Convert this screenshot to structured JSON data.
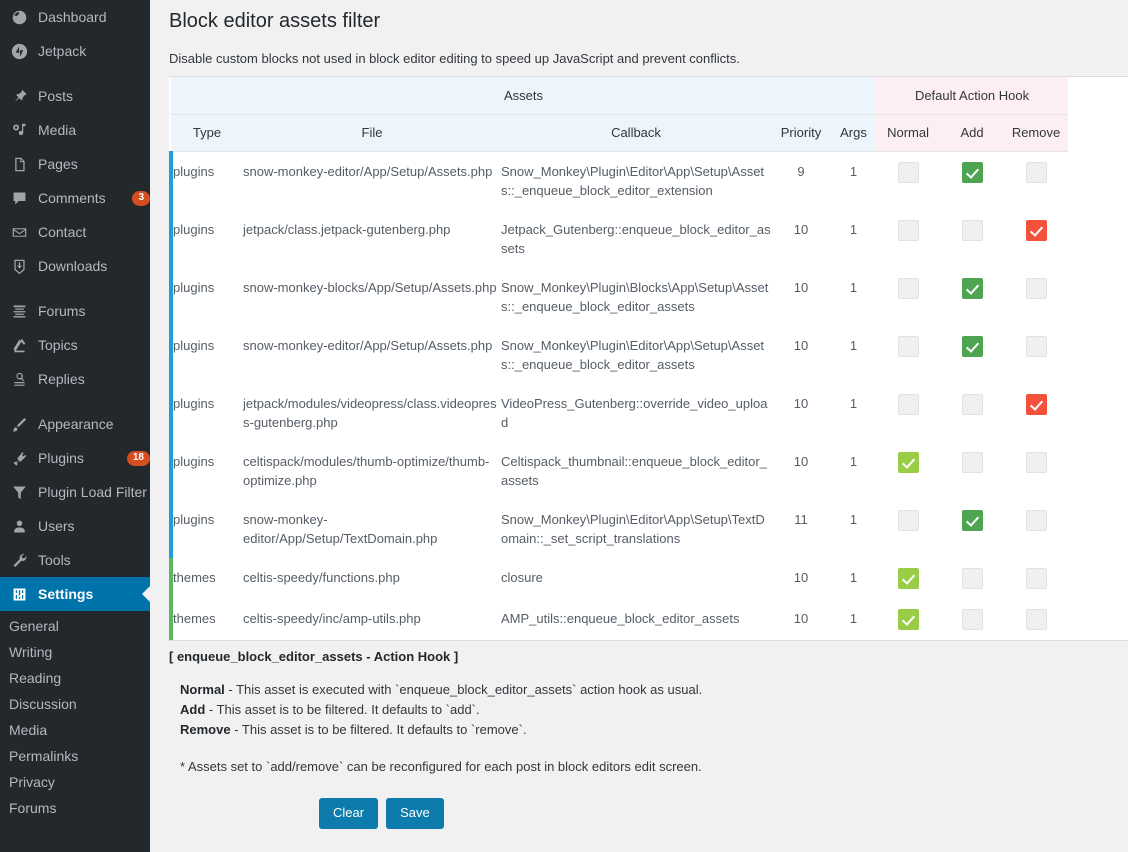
{
  "sidebar": {
    "items": [
      {
        "label": "Dashboard",
        "icon": "dashboard-icon",
        "name": "sidebar-item-dashboard",
        "gap": false
      },
      {
        "label": "Jetpack",
        "icon": "jetpack-icon",
        "name": "sidebar-item-jetpack",
        "gap": false
      },
      {
        "label": "Posts",
        "icon": "pin-icon",
        "name": "sidebar-item-posts",
        "gap": true
      },
      {
        "label": "Media",
        "icon": "media-icon",
        "name": "sidebar-item-media",
        "gap": false
      },
      {
        "label": "Pages",
        "icon": "pages-icon",
        "name": "sidebar-item-pages",
        "gap": false
      },
      {
        "label": "Comments",
        "icon": "comment-icon",
        "name": "sidebar-item-comments",
        "gap": false,
        "badge": "3"
      },
      {
        "label": "Contact",
        "icon": "envelope-icon",
        "name": "sidebar-item-contact",
        "gap": false
      },
      {
        "label": "Downloads",
        "icon": "download-icon",
        "name": "sidebar-item-downloads",
        "gap": false
      },
      {
        "label": "Forums",
        "icon": "forums-icon",
        "name": "sidebar-item-forums",
        "gap": true
      },
      {
        "label": "Topics",
        "icon": "topics-icon",
        "name": "sidebar-item-topics",
        "gap": false
      },
      {
        "label": "Replies",
        "icon": "replies-icon",
        "name": "sidebar-item-replies",
        "gap": false
      },
      {
        "label": "Appearance",
        "icon": "brush-icon",
        "name": "sidebar-item-appearance",
        "gap": true
      },
      {
        "label": "Plugins",
        "icon": "plugin-icon",
        "name": "sidebar-item-plugins",
        "gap": false,
        "badge": "18"
      },
      {
        "label": "Plugin Load Filter",
        "icon": "filter-icon",
        "name": "sidebar-item-plugin-load-filter",
        "gap": false
      },
      {
        "label": "Users",
        "icon": "user-icon",
        "name": "sidebar-item-users",
        "gap": false
      },
      {
        "label": "Tools",
        "icon": "wrench-icon",
        "name": "sidebar-item-tools",
        "gap": false
      },
      {
        "label": "Settings",
        "icon": "settings-icon",
        "name": "sidebar-item-settings",
        "gap": false,
        "current": true
      }
    ],
    "submenu": [
      {
        "label": "General",
        "name": "submenu-item-general"
      },
      {
        "label": "Writing",
        "name": "submenu-item-writing"
      },
      {
        "label": "Reading",
        "name": "submenu-item-reading"
      },
      {
        "label": "Discussion",
        "name": "submenu-item-discussion"
      },
      {
        "label": "Media",
        "name": "submenu-item-media"
      },
      {
        "label": "Permalinks",
        "name": "submenu-item-permalinks"
      },
      {
        "label": "Privacy",
        "name": "submenu-item-privacy"
      },
      {
        "label": "Forums",
        "name": "submenu-item-forums"
      }
    ],
    "accent_current": "#0073aa",
    "badge_color": "#d54e21"
  },
  "page": {
    "title": "Block editor assets filter",
    "description": "Disable custom blocks not used in block editor editing to speed up JavaScript and prevent conflicts."
  },
  "table": {
    "group_headers": [
      {
        "label": "Assets",
        "name": "group-header-assets",
        "color": "#eef4fb"
      },
      {
        "label": "Default Action Hook",
        "name": "group-header-default-action-hook",
        "color": "#fdeef1"
      }
    ],
    "columns": [
      {
        "label": "Type",
        "name": "column-header-type"
      },
      {
        "label": "File",
        "name": "column-header-file"
      },
      {
        "label": "Callback",
        "name": "column-header-callback"
      },
      {
        "label": "Priority",
        "name": "column-header-priority"
      },
      {
        "label": "Args",
        "name": "column-header-args"
      },
      {
        "label": "Normal",
        "name": "column-header-normal"
      },
      {
        "label": "Add",
        "name": "column-header-add"
      },
      {
        "label": "Remove",
        "name": "column-header-remove"
      }
    ],
    "rows": [
      {
        "type": "plugins",
        "file": "snow-monkey-editor/App/Setup/Assets.php",
        "callback": "Snow_Monkey\\Plugin\\Editor\\App\\Setup\\Assets::_enqueue_block_editor_extension",
        "priority": "9",
        "args": "1",
        "normal": false,
        "add": true,
        "remove": false
      },
      {
        "type": "plugins",
        "file": "jetpack/class.jetpack-gutenberg.php",
        "callback": "Jetpack_Gutenberg::enqueue_block_editor_assets",
        "priority": "10",
        "args": "1",
        "normal": false,
        "add": false,
        "remove": true
      },
      {
        "type": "plugins",
        "file": "snow-monkey-blocks/App/Setup/Assets.php",
        "callback": "Snow_Monkey\\Plugin\\Blocks\\App\\Setup\\Assets::_enqueue_block_editor_assets",
        "priority": "10",
        "args": "1",
        "normal": false,
        "add": true,
        "remove": false
      },
      {
        "type": "plugins",
        "file": "snow-monkey-editor/App/Setup/Assets.php",
        "callback": "Snow_Monkey\\Plugin\\Editor\\App\\Setup\\Assets::_enqueue_block_editor_assets",
        "priority": "10",
        "args": "1",
        "normal": false,
        "add": true,
        "remove": false
      },
      {
        "type": "plugins",
        "file": "jetpack/modules/videopress/class.videopress-gutenberg.php",
        "callback": "VideoPress_Gutenberg::override_video_upload",
        "priority": "10",
        "args": "1",
        "normal": false,
        "add": false,
        "remove": true
      },
      {
        "type": "plugins",
        "file": "celtispack/modules/thumb-optimize/thumb-optimize.php",
        "callback": "Celtispack_thumbnail::enqueue_block_editor_assets",
        "priority": "10",
        "args": "1",
        "normal": true,
        "add": false,
        "remove": false
      },
      {
        "type": "plugins",
        "file": "snow-monkey-editor/App/Setup/TextDomain.php",
        "callback": "Snow_Monkey\\Plugin\\Editor\\App\\Setup\\TextDomain::_set_script_translations",
        "priority": "11",
        "args": "1",
        "normal": false,
        "add": true,
        "remove": false
      },
      {
        "type": "themes",
        "file": "celtis-speedy/functions.php",
        "callback": "closure",
        "priority": "10",
        "args": "1",
        "normal": true,
        "add": false,
        "remove": false
      },
      {
        "type": "themes",
        "file": "celtis-speedy/inc/amp-utils.php",
        "callback": "AMP_utils::enqueue_block_editor_assets",
        "priority": "10",
        "args": "1",
        "normal": true,
        "add": false,
        "remove": false
      }
    ],
    "colors": {
      "plugins_bar": "#1e9fd8",
      "themes_bar": "#5cb85c",
      "normal_checked": "#9acd47",
      "add_checked": "#4fa452",
      "remove_checked": "#f4513c",
      "unchecked": "#f0f0f0"
    }
  },
  "legend": {
    "title": "[ enqueue_block_editor_assets - Action Hook ]",
    "entries": [
      {
        "term": "Normal",
        "desc": " - This asset is executed with `enqueue_block_editor_assets` action hook as usual."
      },
      {
        "term": "Add",
        "desc": " - This asset is to be filtered. It defaults to `add`."
      },
      {
        "term": "Remove",
        "desc": " - This asset is to be filtered. It defaults to `remove`."
      }
    ],
    "note": "* Assets set to `add/remove` can be reconfigured for each post in block editors edit screen."
  },
  "buttons": {
    "clear": "Clear",
    "save": "Save",
    "color": "#0d7bab"
  }
}
